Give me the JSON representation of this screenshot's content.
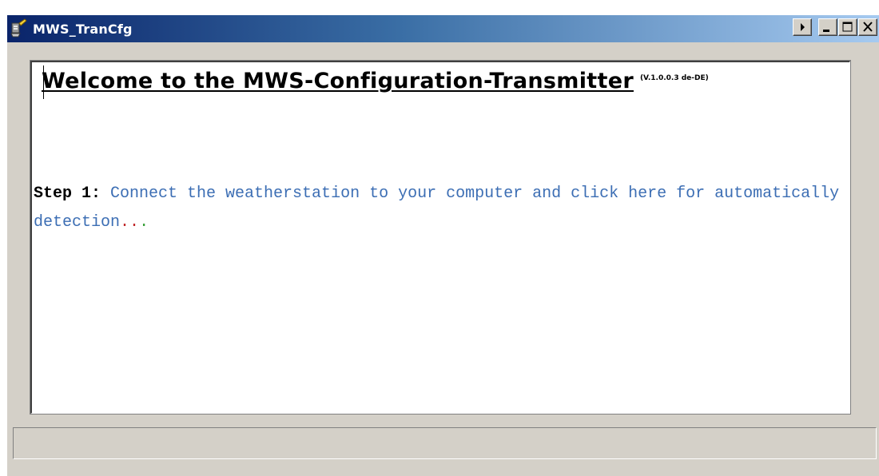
{
  "window": {
    "title": "MWS_TranCfg",
    "icon": "wrench-app-icon",
    "controls": [
      "menu-arrow-icon",
      "minimize-icon",
      "maximize-icon",
      "close-icon"
    ]
  },
  "content": {
    "heading": "Welcome to the MWS-Configuration-Transmitter",
    "version": "(V.1.0.0.3 de-DE)",
    "step_label": "Step 1:",
    "step_text": " Connect the weatherstation to your computer and click here for automatically detection",
    "dot1": ".",
    "dot2": ".",
    "dot3": "."
  },
  "statusbar": {
    "text": ""
  },
  "colors": {
    "link": "#3c6eb4",
    "dot_red": "#c0282a",
    "dot_green": "#3aa03a",
    "title_gradient_start": "#0a246a",
    "title_gradient_end": "#a6caf0",
    "face": "#d4d0c8"
  }
}
